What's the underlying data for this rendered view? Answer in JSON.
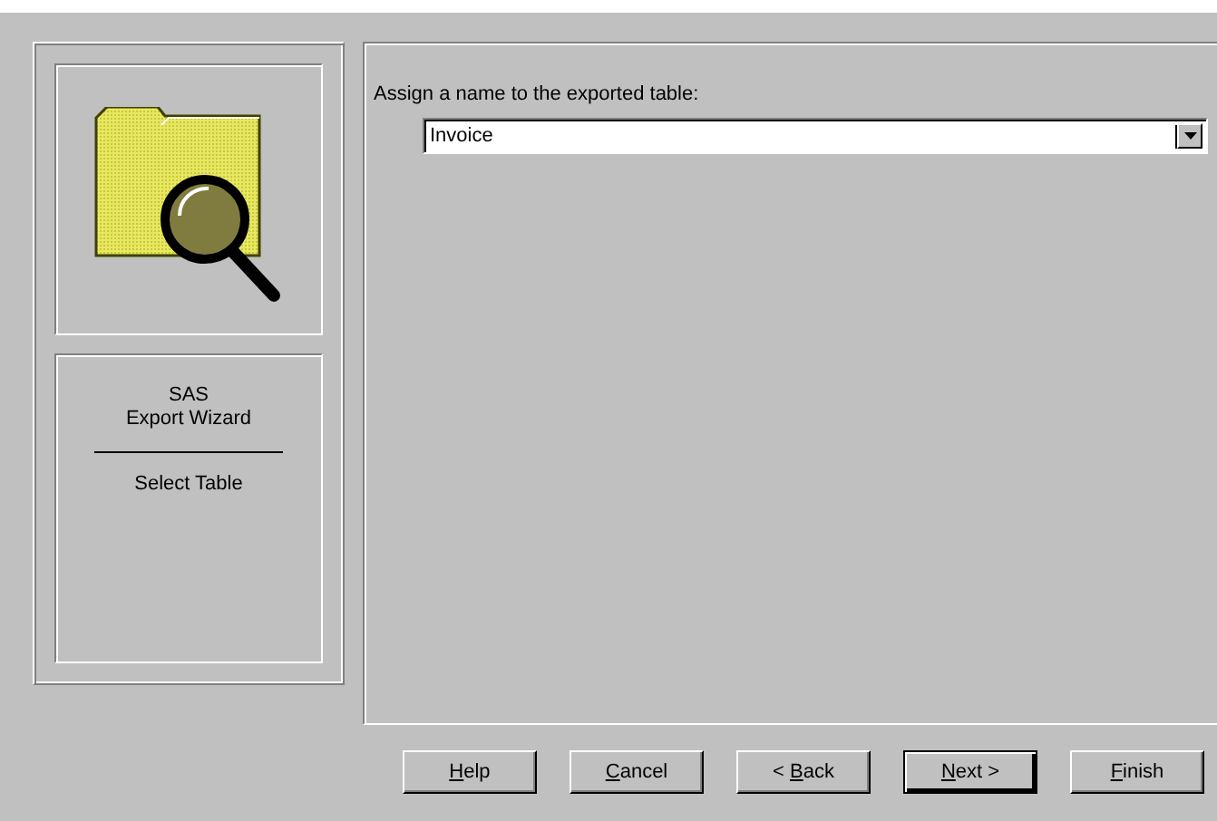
{
  "sidebar": {
    "title_lines": [
      "SAS",
      "Export Wizard"
    ],
    "step": "Select Table"
  },
  "prompt": "Assign a name to the exported table:",
  "table_name": {
    "value": "Invoice"
  },
  "buttons": [
    {
      "key": "H",
      "after": "elp",
      "default": false
    },
    {
      "key": "C",
      "after": "ancel",
      "default": false
    },
    {
      "before": "< ",
      "key": "B",
      "after": "ack",
      "default": false
    },
    {
      "key": "N",
      "after": "ext >",
      "default": true
    },
    {
      "key": "F",
      "after": "inish",
      "default": false
    }
  ]
}
